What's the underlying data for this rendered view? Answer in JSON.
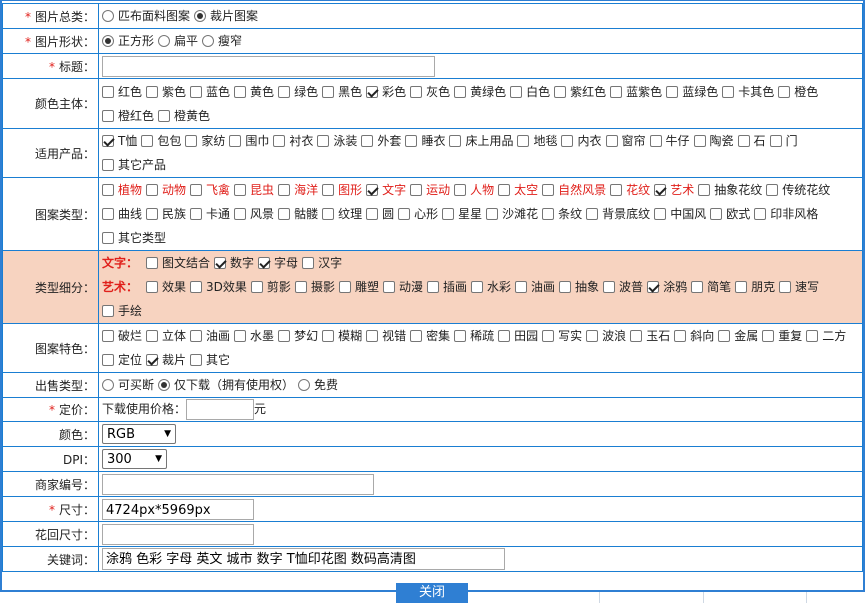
{
  "category": {
    "label": "图片总类：",
    "options": [
      {
        "label": "匹布面料图案",
        "selected": false
      },
      {
        "label": "裁片图案",
        "selected": true
      }
    ]
  },
  "shape": {
    "label": "图片形状：",
    "options": [
      {
        "label": "正方形",
        "selected": true
      },
      {
        "label": "扁平",
        "selected": false
      },
      {
        "label": "瘦窄",
        "selected": false
      }
    ]
  },
  "title": {
    "label": "标题：",
    "value": ""
  },
  "color_theme": {
    "label": "颜色主体：",
    "options": [
      {
        "label": "红色",
        "checked": false
      },
      {
        "label": "紫色",
        "checked": false
      },
      {
        "label": "蓝色",
        "checked": false
      },
      {
        "label": "黄色",
        "checked": false
      },
      {
        "label": "绿色",
        "checked": false
      },
      {
        "label": "黑色",
        "checked": false
      },
      {
        "label": "彩色",
        "checked": true
      },
      {
        "label": "灰色",
        "checked": false
      },
      {
        "label": "黄绿色",
        "checked": false
      },
      {
        "label": "白色",
        "checked": false
      },
      {
        "label": "紫红色",
        "checked": false
      },
      {
        "label": "蓝紫色",
        "checked": false
      },
      {
        "label": "蓝绿色",
        "checked": false
      },
      {
        "label": "卡其色",
        "checked": false
      },
      {
        "label": "橙色",
        "checked": false
      },
      {
        "label": "橙红色",
        "checked": false
      },
      {
        "label": "橙黄色",
        "checked": false
      }
    ]
  },
  "products": {
    "label": "适用产品：",
    "options": [
      {
        "label": "T恤",
        "checked": true
      },
      {
        "label": "包包",
        "checked": false
      },
      {
        "label": "家纺",
        "checked": false
      },
      {
        "label": "围巾",
        "checked": false
      },
      {
        "label": "衬衣",
        "checked": false
      },
      {
        "label": "泳装",
        "checked": false
      },
      {
        "label": "外套",
        "checked": false
      },
      {
        "label": "睡衣",
        "checked": false
      },
      {
        "label": "床上用品",
        "checked": false
      },
      {
        "label": "地毯",
        "checked": false
      },
      {
        "label": "内衣",
        "checked": false
      },
      {
        "label": "窗帘",
        "checked": false
      },
      {
        "label": "牛仔",
        "checked": false
      },
      {
        "label": "陶瓷",
        "checked": false
      },
      {
        "label": "石",
        "checked": false
      },
      {
        "label": "门",
        "checked": false
      },
      {
        "label": "其它产品",
        "checked": false
      }
    ]
  },
  "pattern_type": {
    "label": "图案类型：",
    "options": [
      {
        "label": "植物",
        "checked": false,
        "red": true
      },
      {
        "label": "动物",
        "checked": false,
        "red": true
      },
      {
        "label": "飞禽",
        "checked": false,
        "red": true
      },
      {
        "label": "昆虫",
        "checked": false,
        "red": true
      },
      {
        "label": "海洋",
        "checked": false,
        "red": true
      },
      {
        "label": "图形",
        "checked": false,
        "red": true
      },
      {
        "label": "文字",
        "checked": true,
        "red": true
      },
      {
        "label": "运动",
        "checked": false,
        "red": true
      },
      {
        "label": "人物",
        "checked": false,
        "red": true
      },
      {
        "label": "太空",
        "checked": false,
        "red": true
      },
      {
        "label": "自然风景",
        "checked": false,
        "red": true
      },
      {
        "label": "花纹",
        "checked": false,
        "red": true
      },
      {
        "label": "艺术",
        "checked": true,
        "red": true
      },
      {
        "label": "抽象花纹",
        "checked": false,
        "red": false
      },
      {
        "label": "传统花纹",
        "checked": false,
        "red": false
      },
      {
        "label": "曲线",
        "checked": false,
        "red": false
      },
      {
        "label": "民族",
        "checked": false,
        "red": false
      },
      {
        "label": "卡通",
        "checked": false,
        "red": false
      },
      {
        "label": "风景",
        "checked": false,
        "red": false
      },
      {
        "label": "骷髅",
        "checked": false,
        "red": false
      },
      {
        "label": "纹理",
        "checked": false,
        "red": false
      },
      {
        "label": "圆",
        "checked": false,
        "red": false
      },
      {
        "label": "心形",
        "checked": false,
        "red": false
      },
      {
        "label": "星星",
        "checked": false,
        "red": false
      },
      {
        "label": "沙滩花",
        "checked": false,
        "red": false
      },
      {
        "label": "条纹",
        "checked": false,
        "red": false
      },
      {
        "label": "背景底纹",
        "checked": false,
        "red": false
      },
      {
        "label": "中国风",
        "checked": false,
        "red": false
      },
      {
        "label": "欧式",
        "checked": false,
        "red": false
      },
      {
        "label": "印非风格",
        "checked": false,
        "red": false
      },
      {
        "label": "其它类型",
        "checked": false,
        "red": false
      }
    ]
  },
  "subtype": {
    "label": "类型细分：",
    "text_group": {
      "label": "文字：",
      "options": [
        {
          "label": "图文结合",
          "checked": false
        },
        {
          "label": "数字",
          "checked": true
        },
        {
          "label": "字母",
          "checked": true
        },
        {
          "label": "汉字",
          "checked": false
        }
      ]
    },
    "art_group": {
      "label": "艺术：",
      "options": [
        {
          "label": "效果",
          "checked": false
        },
        {
          "label": "3D效果",
          "checked": false
        },
        {
          "label": "剪影",
          "checked": false
        },
        {
          "label": "摄影",
          "checked": false
        },
        {
          "label": "雕塑",
          "checked": false
        },
        {
          "label": "动漫",
          "checked": false
        },
        {
          "label": "插画",
          "checked": false
        },
        {
          "label": "水彩",
          "checked": false
        },
        {
          "label": "油画",
          "checked": false
        },
        {
          "label": "抽象",
          "checked": false
        },
        {
          "label": "波普",
          "checked": false
        },
        {
          "label": "涂鸦",
          "checked": true
        },
        {
          "label": "简笔",
          "checked": false
        },
        {
          "label": "朋克",
          "checked": false
        },
        {
          "label": "速写",
          "checked": false
        },
        {
          "label": "手绘",
          "checked": false
        }
      ]
    }
  },
  "features": {
    "label": "图案特色：",
    "options": [
      {
        "label": "破烂",
        "checked": false
      },
      {
        "label": "立体",
        "checked": false
      },
      {
        "label": "油画",
        "checked": false
      },
      {
        "label": "水墨",
        "checked": false
      },
      {
        "label": "梦幻",
        "checked": false
      },
      {
        "label": "模糊",
        "checked": false
      },
      {
        "label": "视错",
        "checked": false
      },
      {
        "label": "密集",
        "checked": false
      },
      {
        "label": "稀疏",
        "checked": false
      },
      {
        "label": "田园",
        "checked": false
      },
      {
        "label": "写实",
        "checked": false
      },
      {
        "label": "波浪",
        "checked": false
      },
      {
        "label": "玉石",
        "checked": false
      },
      {
        "label": "斜向",
        "checked": false
      },
      {
        "label": "金属",
        "checked": false
      },
      {
        "label": "重复",
        "checked": false
      },
      {
        "label": "二方",
        "checked": false
      },
      {
        "label": "定位",
        "checked": false
      },
      {
        "label": "裁片",
        "checked": true
      },
      {
        "label": "其它",
        "checked": false
      }
    ]
  },
  "sale_type": {
    "label": "出售类型：",
    "options": [
      {
        "label": "可买断",
        "selected": false
      },
      {
        "label": "仅下载（拥有使用权）",
        "selected": true
      },
      {
        "label": "免费",
        "selected": false
      }
    ]
  },
  "price": {
    "label": "定价：",
    "prefix": "下载使用价格：",
    "value": "",
    "unit": "元"
  },
  "color_mode": {
    "label": "颜色：",
    "value": "RGB"
  },
  "dpi": {
    "label": "DPI：",
    "value": "300"
  },
  "merchant": {
    "label": "商家编号：",
    "value": ""
  },
  "size": {
    "label": "尺寸：",
    "value": "4724px*5969px"
  },
  "repeat_size": {
    "label": "花回尺寸：",
    "value": ""
  },
  "keywords": {
    "label": "关键词：",
    "value": "涂鸦 色彩 字母 英文 城市 数字 T恤印花图 数码高清图"
  },
  "close_label": "关闭"
}
